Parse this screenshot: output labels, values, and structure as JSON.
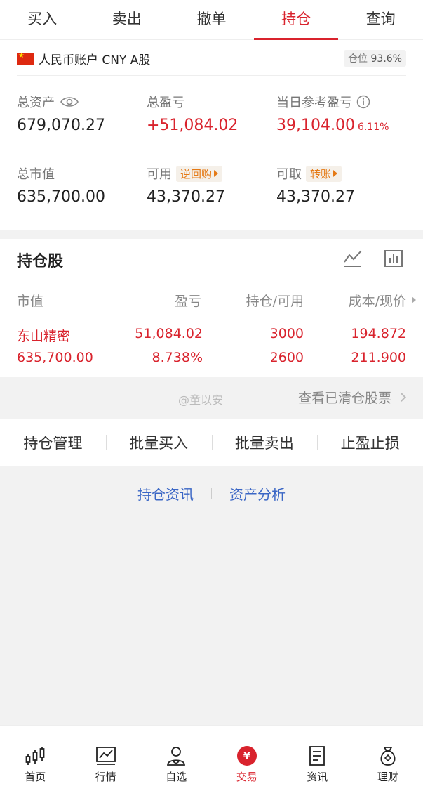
{
  "top_tabs": [
    {
      "label": "买入"
    },
    {
      "label": "卖出"
    },
    {
      "label": "撤单"
    },
    {
      "label": "持仓"
    },
    {
      "label": "查询"
    }
  ],
  "active_tab": "持仓",
  "account": {
    "name": "人民币账户 CNY A股",
    "position_label": "仓位",
    "position_value": "93.6%"
  },
  "stats": {
    "total_assets_label": "总资产",
    "total_assets": "679,070.27",
    "total_pnl_label": "总盈亏",
    "total_pnl": "+51,084.02",
    "daily_pnl_label": "当日参考盈亏",
    "daily_pnl": "39,104.00",
    "daily_pnl_pct": "6.11%",
    "market_value_label": "总市值",
    "market_value": "635,700.00",
    "available_label": "可用",
    "available_tag": "逆回购",
    "available": "43,370.27",
    "withdrawable_label": "可取",
    "withdrawable_tag": "转账",
    "withdrawable": "43,370.27"
  },
  "holdings": {
    "title": "持仓股",
    "columns": [
      "市值",
      "盈亏",
      "持仓/可用",
      "成本/现价"
    ],
    "rows": [
      {
        "name": "东山精密",
        "market_value": "635,700.00",
        "pnl": "51,084.02",
        "pnl_pct": "8.738%",
        "position": "3000",
        "available": "2600",
        "cost": "194.872",
        "price": "211.900"
      }
    ]
  },
  "watermark": "@童以安",
  "cleared_link": "查看已清仓股票",
  "actions": [
    "持仓管理",
    "批量买入",
    "批量卖出",
    "止盈止损"
  ],
  "links": [
    "持仓资讯",
    "资产分析"
  ],
  "bottom_nav": [
    {
      "label": "首页",
      "icon": "candlestick-icon"
    },
    {
      "label": "行情",
      "icon": "chart-icon"
    },
    {
      "label": "自选",
      "icon": "user-icon"
    },
    {
      "label": "交易",
      "icon": "yuan-icon"
    },
    {
      "label": "资讯",
      "icon": "document-icon"
    },
    {
      "label": "理财",
      "icon": "money-bag-icon"
    }
  ],
  "colors": {
    "accent": "#d9232d",
    "link": "#3a66c5",
    "tag": "#e57a16"
  }
}
